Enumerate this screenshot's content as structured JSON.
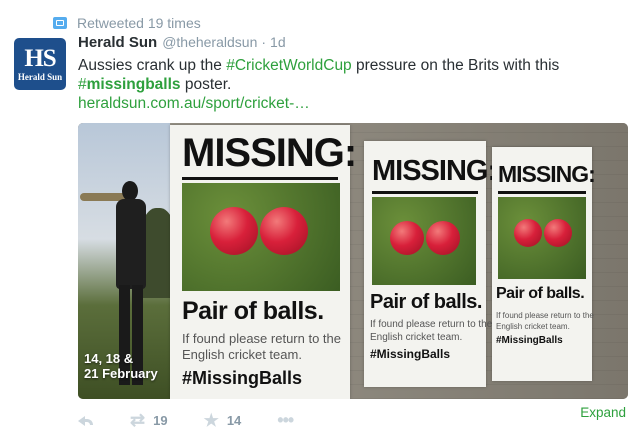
{
  "retweet_context": {
    "text": "Retweeted 19 times",
    "icon": "retweet-context-icon"
  },
  "author": {
    "name": "Herald Sun",
    "handle": "@theheraldsun",
    "separator": "·",
    "time": "1d",
    "avatar": {
      "initials": "HS",
      "label": "Herald Sun"
    }
  },
  "tweet": {
    "text_before": "Aussies crank up the ",
    "hashtag1": "#CricketWorldCup",
    "text_middle": " pressure on the Brits with this",
    "hashtag2_symbol": "#",
    "hashtag2": "missingballs",
    "text_after": " poster.",
    "link": "heraldsun.com.au/sport/cricket-…"
  },
  "media": {
    "dates_line1": "14, 18 &",
    "dates_line2": "21 February",
    "poster": {
      "headline": "MISSING:",
      "subhead": "Pair of balls.",
      "body_line1": "If found please return to the",
      "body_line2": "English cricket team.",
      "hashtag": "#MissingBalls"
    }
  },
  "actions": {
    "reply_icon": "reply-icon",
    "retweet_icon": "retweet-icon",
    "retweet_count": "19",
    "favorite_icon": "star-icon",
    "favorite_count": "14",
    "more_icon": "more-icon",
    "expand": "Expand"
  },
  "colors": {
    "accent": "#2ea03d",
    "muted": "#8899a6",
    "avatar_bg": "#1e4f8c"
  }
}
